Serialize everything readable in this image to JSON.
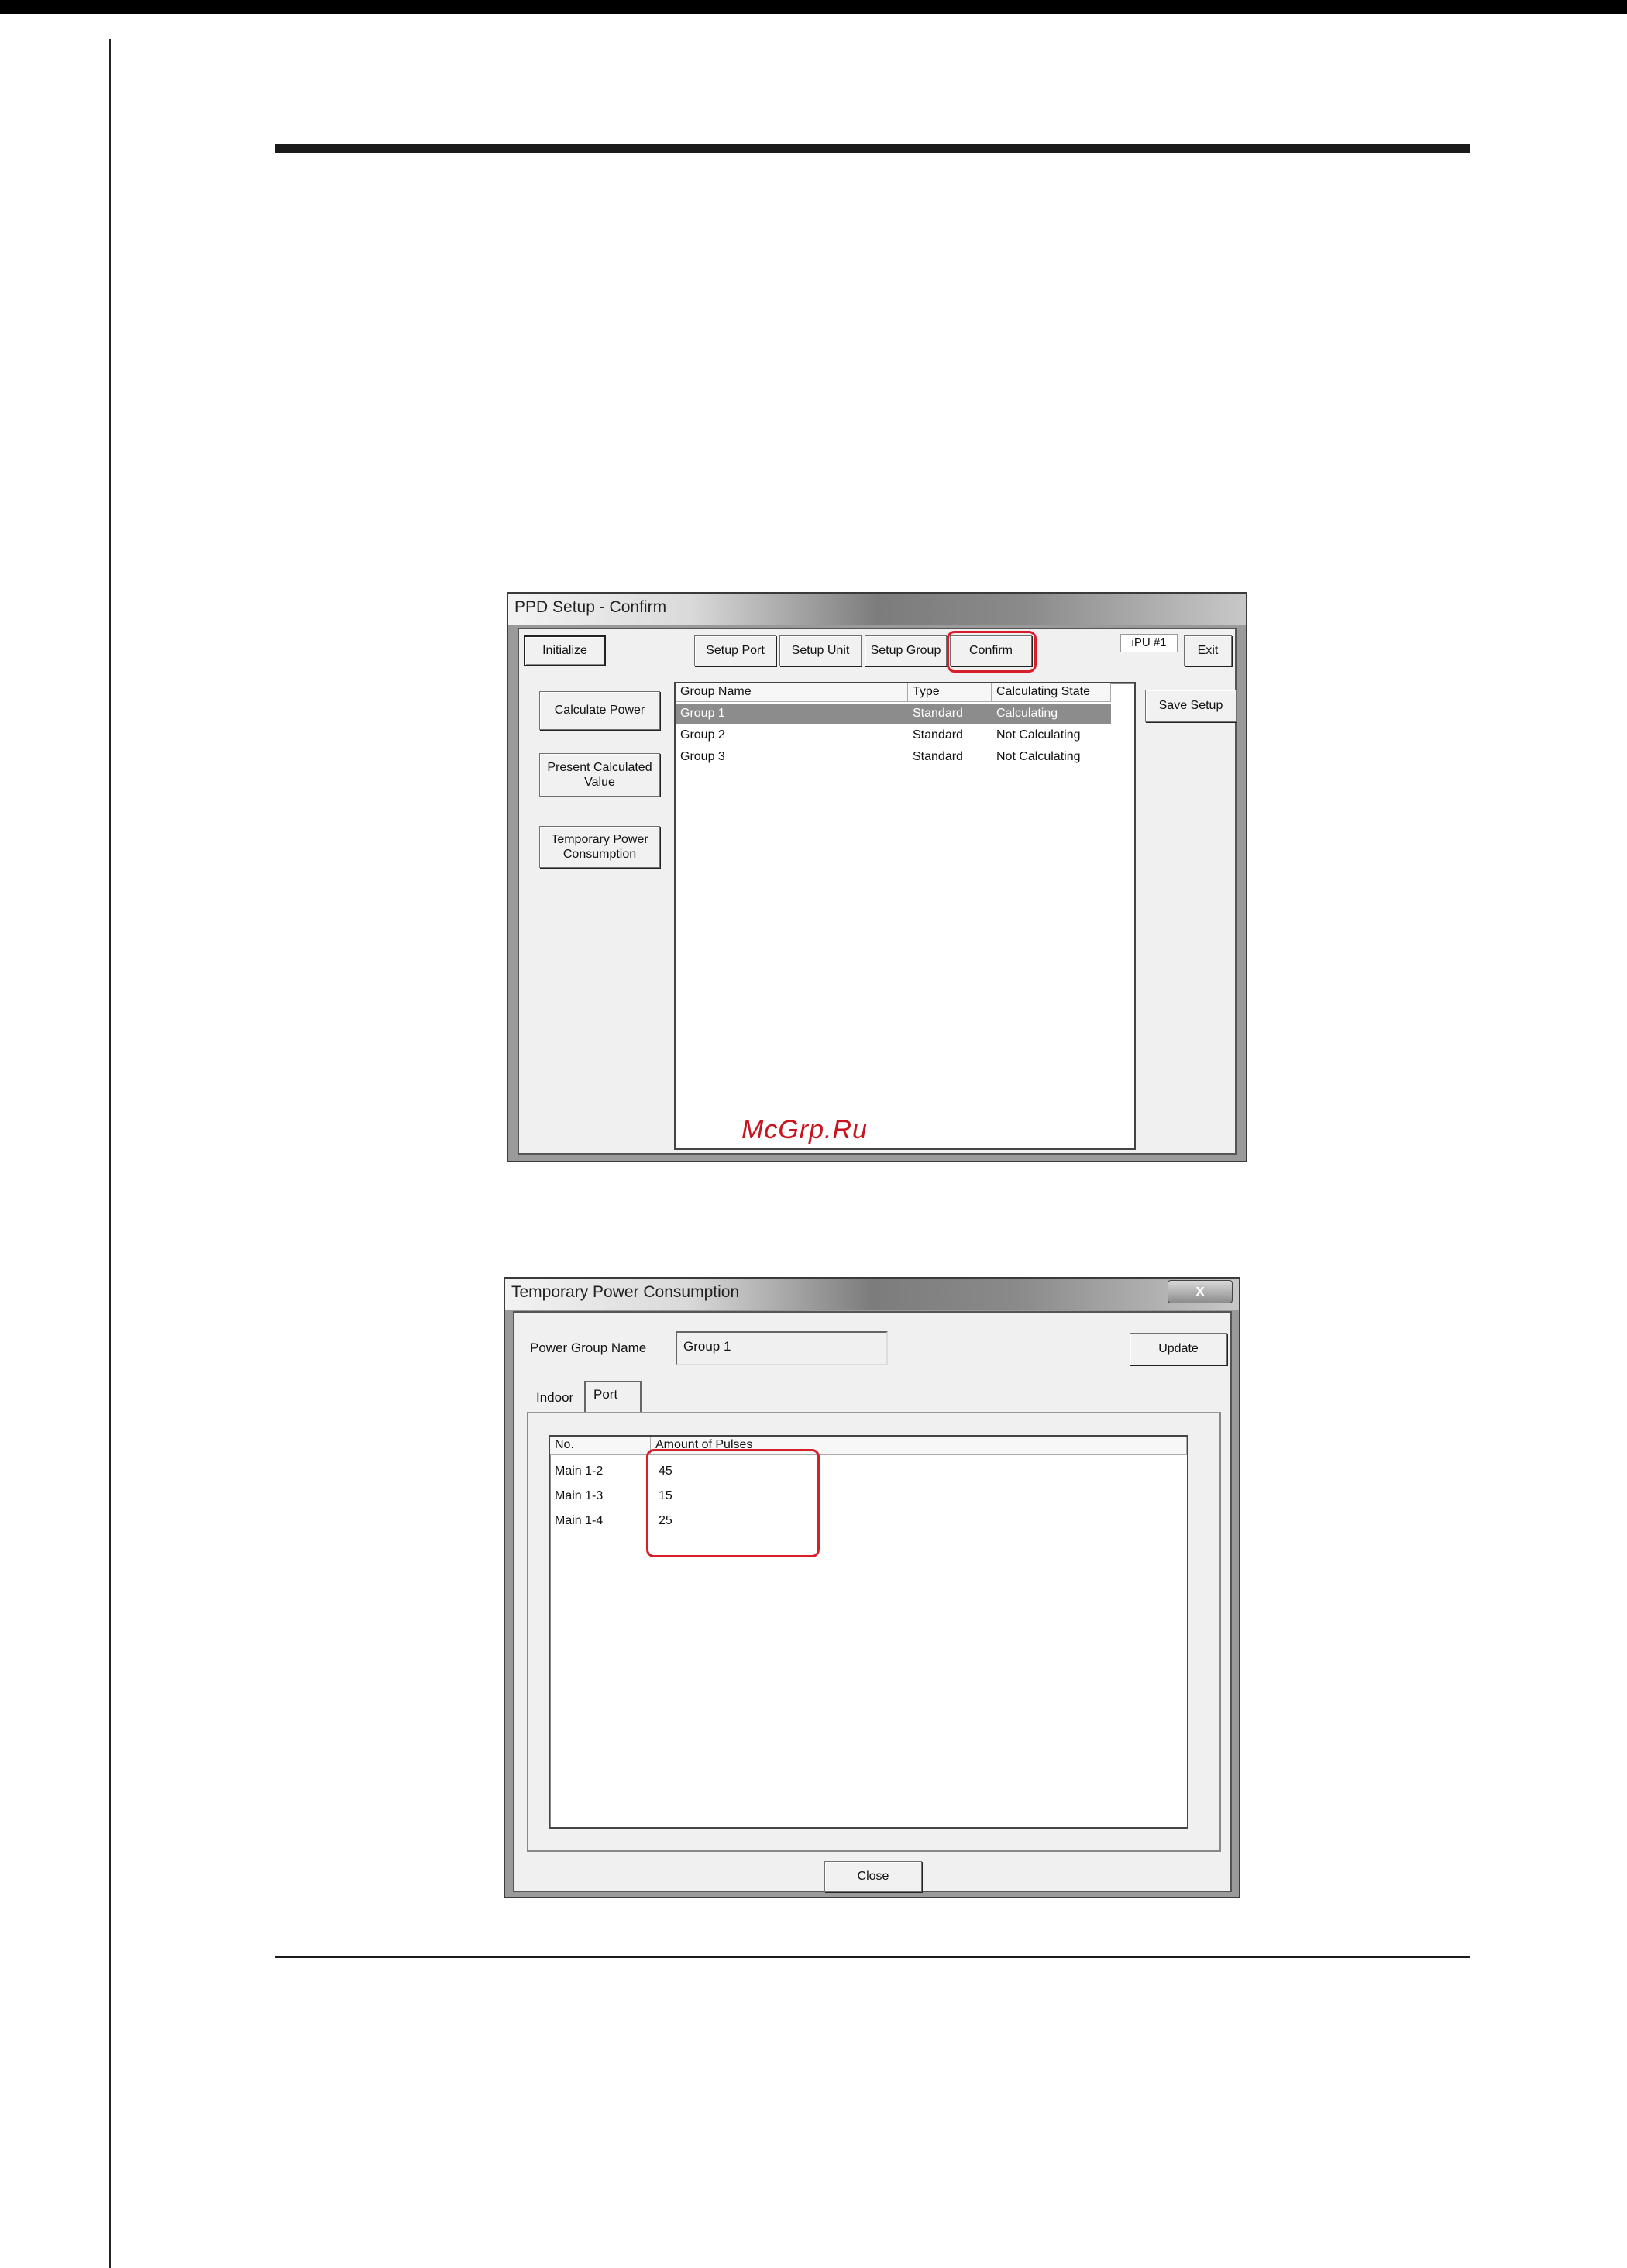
{
  "window1": {
    "title": "PPD Setup - Confirm",
    "toolbar": {
      "initialize": "Initialize",
      "setup_port": "Setup Port",
      "setup_unit": "Setup Unit",
      "setup_group": "Setup Group",
      "confirm": "Confirm",
      "ipu_label": "iPU #1",
      "exit": "Exit"
    },
    "side_buttons": {
      "calculate_power": "Calculate Power",
      "present_calculated_value": [
        "Present Calculated",
        "Value"
      ],
      "temporary_power_consumption": [
        "Temporary Power",
        "Consumption"
      ]
    },
    "save_setup": "Save Setup",
    "table": {
      "headers": [
        "Group Name",
        "Type",
        "Calculating State"
      ],
      "rows": [
        {
          "name": "Group 1",
          "type": "Standard",
          "state": "Calculating",
          "selected": true
        },
        {
          "name": "Group 2",
          "type": "Standard",
          "state": "Not Calculating",
          "selected": false
        },
        {
          "name": "Group 3",
          "type": "Standard",
          "state": "Not Calculating",
          "selected": false
        }
      ]
    }
  },
  "window2": {
    "title": "Temporary Power Consumption",
    "close_glyph": "x",
    "power_group_label": "Power Group Name",
    "power_group_value": "Group 1",
    "update": "Update",
    "tabs": [
      "Indoor",
      "Port"
    ],
    "active_tab": "Port",
    "table": {
      "headers": [
        "No.",
        "Amount of Pulses"
      ],
      "rows": [
        {
          "no": "Main 1-2",
          "pulses": "45"
        },
        {
          "no": "Main 1-3",
          "pulses": "15"
        },
        {
          "no": "Main 1-4",
          "pulses": "25"
        }
      ]
    },
    "close": "Close"
  },
  "watermark": "McGrp.Ru",
  "colors": {
    "highlight_red": "#d81e2a",
    "selected_row": "#8c8c8c",
    "watermark": "#c8141e"
  }
}
